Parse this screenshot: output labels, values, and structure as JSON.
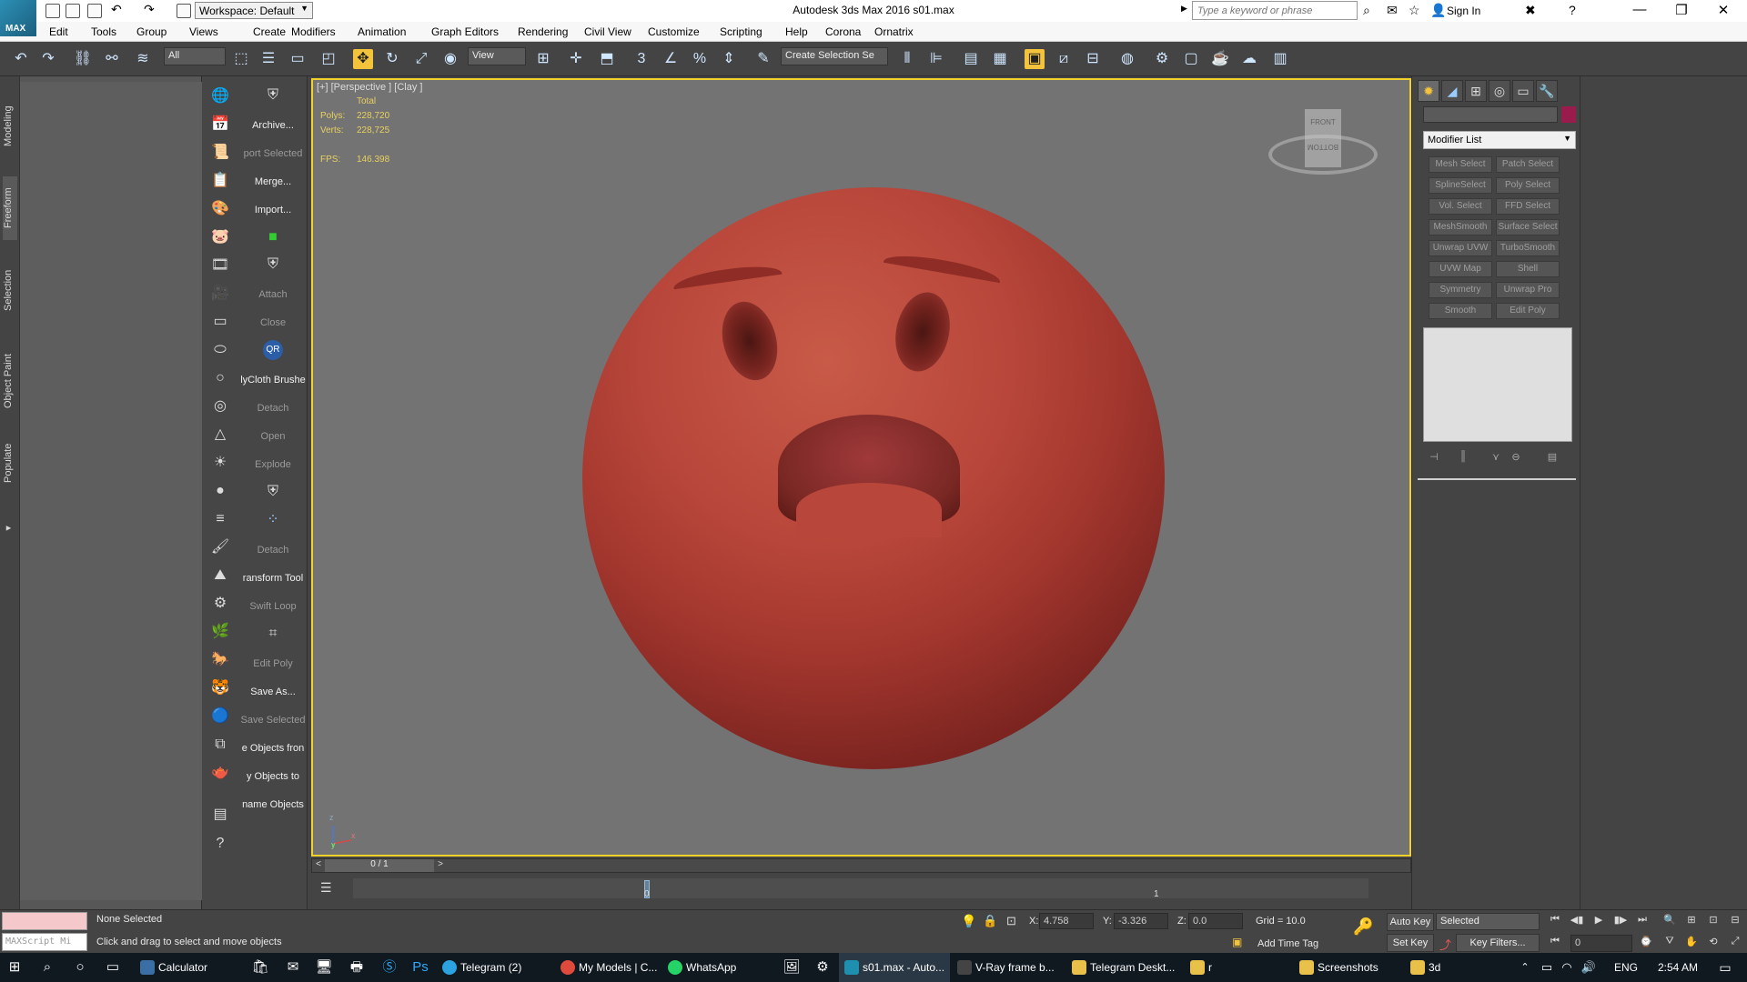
{
  "titlebar": {
    "app_badge": "MAX",
    "workspace": "Workspace: Default",
    "title": "Autodesk 3ds Max 2016     s01.max",
    "search_placeholder": "Type a keyword or phrase",
    "sign_in": "Sign In",
    "minimize": "—",
    "restore": "❐",
    "close": "✕"
  },
  "menu": [
    "Edit",
    "Tools",
    "Group",
    "Views",
    "Create",
    "Modifiers",
    "Animation",
    "Graph Editors",
    "Rendering",
    "Civil View",
    "Customize",
    "Scripting",
    "Help",
    "Corona",
    "Ornatrix"
  ],
  "toolbar": {
    "filter_combo": "All",
    "view_combo": "View",
    "selection_set": "Create Selection Se",
    "snap_label": "3"
  },
  "ribbon_tabs": [
    "Modeling",
    "Freeform",
    "Selection",
    "Object Paint",
    "Populate"
  ],
  "scene_commands": [
    "Archive...",
    "port Selected",
    "Merge...",
    "Import...",
    "Attach",
    "Close",
    "lyCloth Brushe",
    "Detach",
    "Open",
    "Explode",
    "Detach",
    "ransform Tool",
    "Swift Loop",
    "Edit Poly",
    "Save As...",
    "Save Selected",
    "e Objects fron",
    "y Objects to",
    "name Objects"
  ],
  "qr_badge": "QR",
  "viewport": {
    "label": "[+] [Perspective ] [Clay ]",
    "stats_header": "Total",
    "polys_label": "Polys:",
    "polys_value": "228,720",
    "verts_label": "Verts:",
    "verts_value": "228,725",
    "fps_label": "FPS:",
    "fps_value": "146.398",
    "viewcube_front": "FRONT",
    "viewcube_bottom": "BOTTOM",
    "axis_z": "z",
    "axis_x": "x",
    "axis_y": "y"
  },
  "timeline": {
    "position": "0 / 1",
    "tick_0": "0",
    "tick_1": "1",
    "prev": "<",
    "next": ">"
  },
  "command_panel": {
    "modifier_list": "Modifier List",
    "object_color": "#9a1c4c",
    "modifier_buttons": [
      "Mesh Select",
      "Patch Select",
      "SplineSelect",
      "Poly Select",
      "Vol. Select",
      "FFD Select",
      "MeshSmooth",
      "Surface Select",
      "Unwrap UVW",
      "TurboSmooth",
      "UVW Map",
      "Shell",
      "Symmetry",
      "Unwrap Pro",
      "Smooth",
      "Edit Poly"
    ]
  },
  "statusbar": {
    "maxscript": "MAXScript Mi",
    "selection": "None Selected",
    "prompt": "Click and drag to select and move objects",
    "x_label": "X:",
    "x_value": "4.758",
    "y_label": "Y:",
    "y_value": "-3.326",
    "z_label": "Z:",
    "z_value": "0.0",
    "grid": "Grid = 10.0",
    "add_time_tag": "Add Time Tag",
    "auto_key": "Auto Key",
    "set_key": "Set Key",
    "selected_combo": "Selected",
    "key_filters": "Key Filters...",
    "frame": "0"
  },
  "taskbar": {
    "items": [
      "Calculator",
      "Telegram (2)",
      "My Models | C...",
      "WhatsApp",
      "s01.max - Auto...",
      "V-Ray frame b...",
      "Telegram Deskt...",
      "r",
      "Screenshots",
      "3d"
    ],
    "language": "ENG",
    "time": "2:54 AM"
  }
}
